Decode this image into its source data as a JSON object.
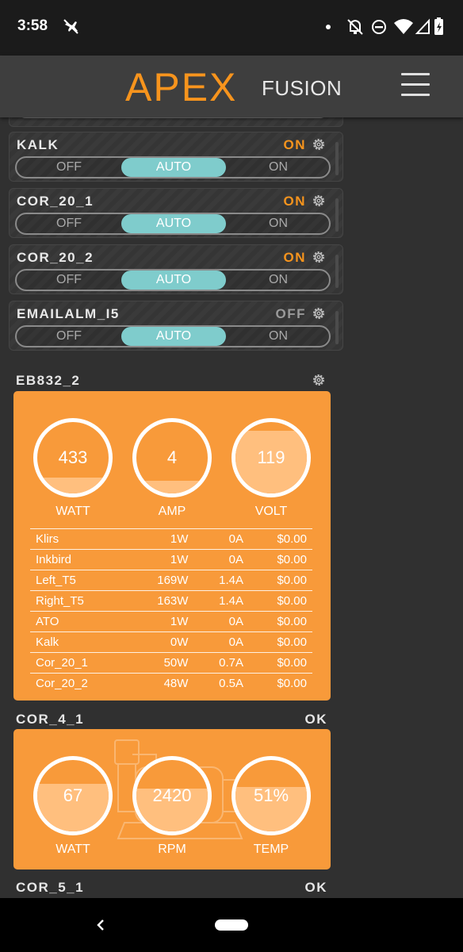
{
  "status_bar": {
    "time": "3:58",
    "icons": [
      "airplane-cancel-icon",
      "dot-icon",
      "bell-off-icon",
      "do-not-disturb-icon",
      "wifi-icon",
      "cell-signal-icon",
      "battery-charging-icon"
    ]
  },
  "header": {
    "logo_apex": "APEX",
    "logo_fusion": "FUSION",
    "menu_icon": "hamburger-menu-icon"
  },
  "outlets": [
    {
      "name": "KALK",
      "state": "ON",
      "opt_off": "OFF",
      "opt_auto": "AUTO",
      "opt_on": "ON",
      "selected": "AUTO"
    },
    {
      "name": "COR_20_1",
      "state": "ON",
      "opt_off": "OFF",
      "opt_auto": "AUTO",
      "opt_on": "ON",
      "selected": "AUTO"
    },
    {
      "name": "COR_20_2",
      "state": "ON",
      "opt_off": "OFF",
      "opt_auto": "AUTO",
      "opt_on": "ON",
      "selected": "AUTO"
    },
    {
      "name": "EMAILALM_I5",
      "state": "OFF",
      "opt_off": "OFF",
      "opt_auto": "AUTO",
      "opt_on": "ON",
      "selected": "AUTO"
    }
  ],
  "eb832": {
    "title": "EB832_2",
    "gauges": [
      {
        "value": "433",
        "label": "WATT",
        "level": 0.22
      },
      {
        "value": "4",
        "label": "AMP",
        "level": 0.18
      },
      {
        "value": "119",
        "label": "VOLT",
        "level": 0.88
      }
    ],
    "rows": [
      {
        "name": "Klirs",
        "watt": "1W",
        "amp": "0A",
        "cost": "$0.00"
      },
      {
        "name": "Inkbird",
        "watt": "1W",
        "amp": "0A",
        "cost": "$0.00"
      },
      {
        "name": "Left_T5",
        "watt": "169W",
        "amp": "1.4A",
        "cost": "$0.00"
      },
      {
        "name": "Right_T5",
        "watt": "163W",
        "amp": "1.4A",
        "cost": "$0.00"
      },
      {
        "name": "ATO",
        "watt": "1W",
        "amp": "0A",
        "cost": "$0.00"
      },
      {
        "name": "Kalk",
        "watt": "0W",
        "amp": "0A",
        "cost": "$0.00"
      },
      {
        "name": "Cor_20_1",
        "watt": "50W",
        "amp": "0.7A",
        "cost": "$0.00"
      },
      {
        "name": "Cor_20_2",
        "watt": "48W",
        "amp": "0.5A",
        "cost": "$0.00"
      }
    ]
  },
  "cor_4_1": {
    "title": "COR_4_1",
    "status": "OK",
    "gauges": [
      {
        "value": "67",
        "label": "WATT",
        "level": 0.67
      },
      {
        "value": "2420",
        "label": "RPM",
        "level": 0.6
      },
      {
        "value": "51%",
        "label": "TEMP",
        "level": 0.62
      }
    ]
  },
  "cor_5_1": {
    "title": "COR_5_1",
    "status": "OK"
  },
  "nav": {
    "back_icon": "back-chevron-icon",
    "home_icon": "home-pill-icon"
  }
}
